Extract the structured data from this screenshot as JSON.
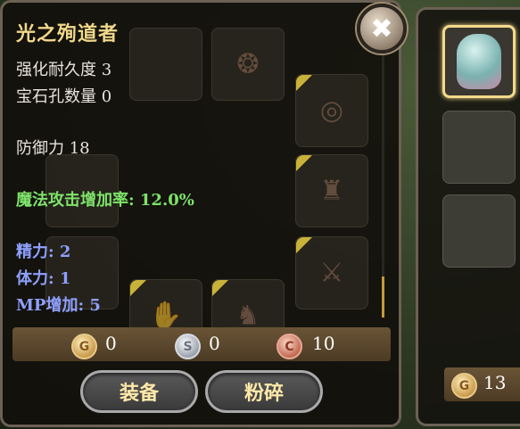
{
  "item": {
    "name": "光之殉道者",
    "durability": "强化耐久度 3",
    "gem_slots": "宝石孔数量 0",
    "defense": "防御力 18",
    "magic_attack_bonus": "魔法攻击增加率: 12.0%",
    "stats": [
      "精力: 2",
      "体力: 1",
      "MP增加: 5"
    ]
  },
  "currency": {
    "gold": {
      "icon": "G",
      "amount": "0"
    },
    "silver": {
      "icon": "S",
      "amount": "0"
    },
    "copper": {
      "icon": "C",
      "amount": "10"
    }
  },
  "buttons": {
    "equip": "装备",
    "shatter": "粉碎"
  },
  "close_icon": "✖",
  "side_panel": {
    "gold": {
      "icon": "G",
      "amount": "13"
    }
  },
  "colors": {
    "title": "#f0d88a",
    "green_stat": "#7ee36a",
    "blue_stat": "#8fa0ff",
    "selected_border": "#f2d98a"
  }
}
